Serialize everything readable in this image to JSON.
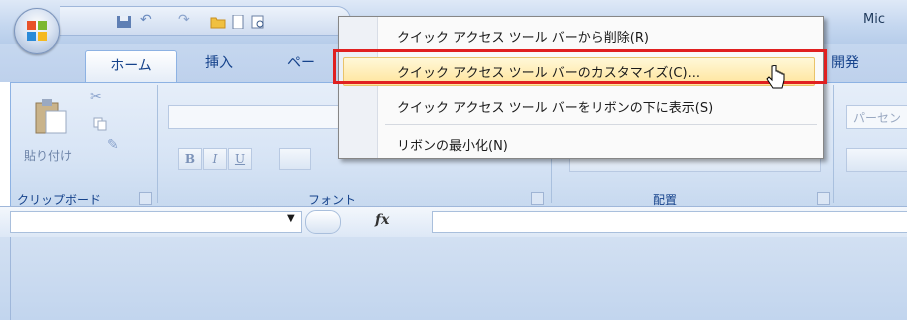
{
  "window": {
    "title": "Mic"
  },
  "tabs": [
    {
      "label": "ホーム"
    },
    {
      "label": "挿入"
    },
    {
      "label": "ペー"
    },
    {
      "label": "開発"
    }
  ],
  "ribbon": {
    "clipboard": {
      "paste_label": "貼り付け",
      "group_label": "クリップボード"
    },
    "font": {
      "group_label": "フォント",
      "bold": "B",
      "italic": "I",
      "underline": "U"
    },
    "alignment": {
      "group_label": "配置"
    },
    "number": {
      "format_value": "パーセン"
    }
  },
  "formula_bar": {
    "fx_label": "fx"
  },
  "context_menu": {
    "items": [
      {
        "label": "クイック アクセス ツール バーから削除(R)"
      },
      {
        "label": "クイック アクセス ツール バーのカスタマイズ(C)..."
      },
      {
        "label": "クイック アクセス ツール バーをリボンの下に表示(S)"
      },
      {
        "label": "リボンの最小化(N)"
      }
    ],
    "highlighted_index": 1
  },
  "colors": {
    "highlight_border": "#e02020",
    "hover_fill": "#ffe49b",
    "ribbon_blue": "#c5d7ef"
  }
}
